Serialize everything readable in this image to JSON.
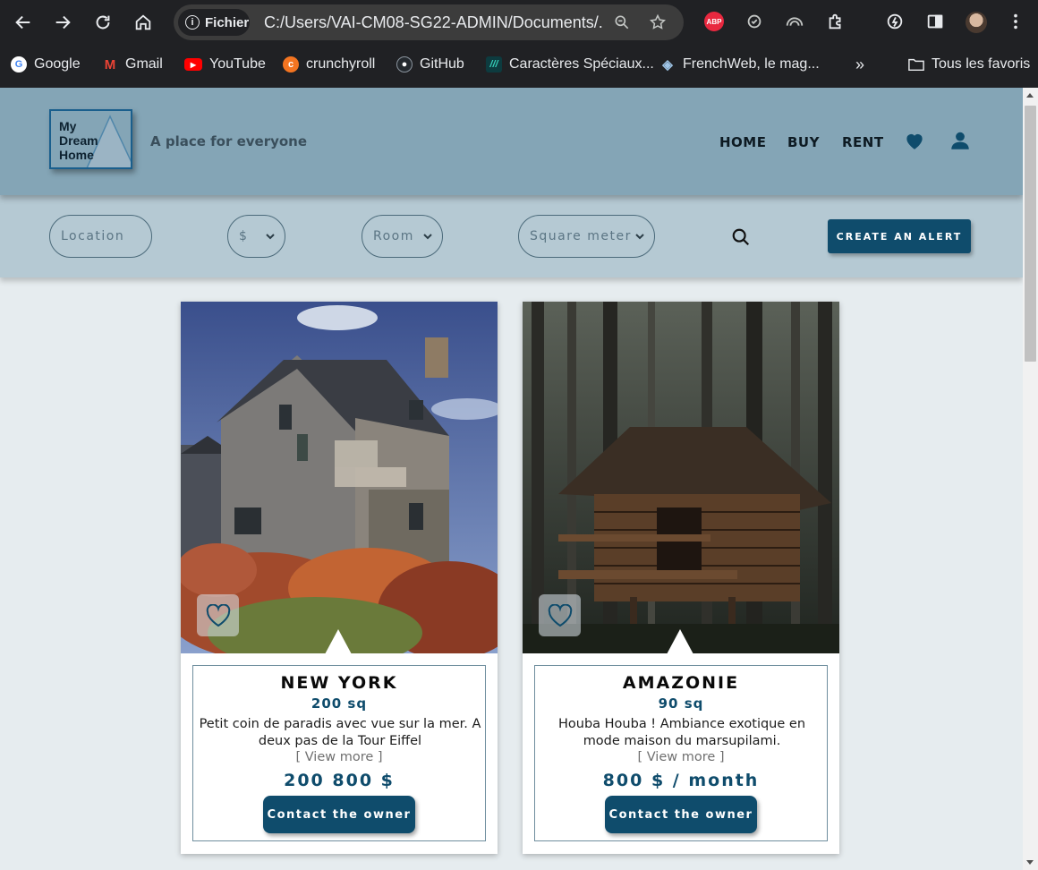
{
  "browser": {
    "site_info_label": "Fichier",
    "url": "C:/Users/VAI-CM08-SG22-ADMIN/Documents/...",
    "abp_label": "ABP",
    "bookmarks": [
      {
        "label": "Google"
      },
      {
        "label": "Gmail"
      },
      {
        "label": "YouTube"
      },
      {
        "label": "crunchyroll"
      },
      {
        "label": "GitHub"
      },
      {
        "label": "Caractères Spéciaux..."
      },
      {
        "label": "FrenchWeb, le mag..."
      }
    ],
    "all_bookmarks_label": "Tous les favoris"
  },
  "header": {
    "logo_text": [
      "My",
      "Dream",
      "Home"
    ],
    "tagline": "A place for everyone",
    "nav": [
      "HOME",
      "BUY",
      "RENT"
    ]
  },
  "filters": {
    "location_placeholder": "Location",
    "price_label": "$",
    "room_label": "Room",
    "square_meter_label": "Square meter",
    "alert_button": "CREATE AN ALERT"
  },
  "listings": [
    {
      "city": "NEW YORK",
      "size": "200 sq",
      "description": "Petit coin de paradis avec vue sur la mer. A deux pas de la Tour Eiffel",
      "view_more": "[ View more ]",
      "price": "200 800 $",
      "contact_label": "Contact the owner"
    },
    {
      "city": "AMAZONIE",
      "size": "90 sq",
      "description": "Houba Houba ! Ambiance exotique en mode maison du marsupilami.",
      "view_more": "[ View more ]",
      "price": "800 $ / month",
      "contact_label": "Contact the owner"
    }
  ],
  "colors": {
    "header_bg": "#84a5b6",
    "filterbar_bg": "#b5c9d3",
    "accent": "#0f4c6c",
    "page_bg": "#e6ecef"
  }
}
